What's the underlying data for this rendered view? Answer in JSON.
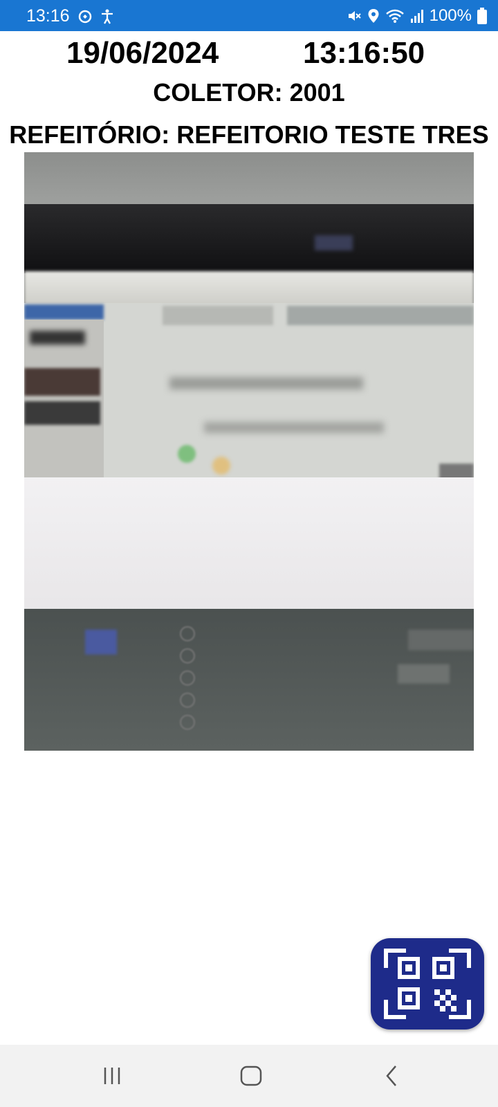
{
  "status_bar": {
    "time": "13:16",
    "battery": "100%",
    "background": "#1976d2",
    "left_icons": [
      "sync-icon",
      "accessibility-icon"
    ],
    "right_icons": [
      "mute-icon",
      "location-icon",
      "wifi-icon",
      "signal-icon",
      "battery-icon"
    ]
  },
  "header": {
    "date": "19/06/2024",
    "time": "13:16:50",
    "coletor": "COLETOR: 2001",
    "refeitorio": "REFEITÓRIO: REFEITORIO TESTE TRES"
  },
  "camera": {
    "icon": "camera-preview"
  },
  "fab": {
    "icon": "qr-scan-icon",
    "color": "#1e2b8a"
  },
  "nav": {
    "icons": [
      "recent-apps-icon",
      "home-icon",
      "back-icon"
    ]
  }
}
